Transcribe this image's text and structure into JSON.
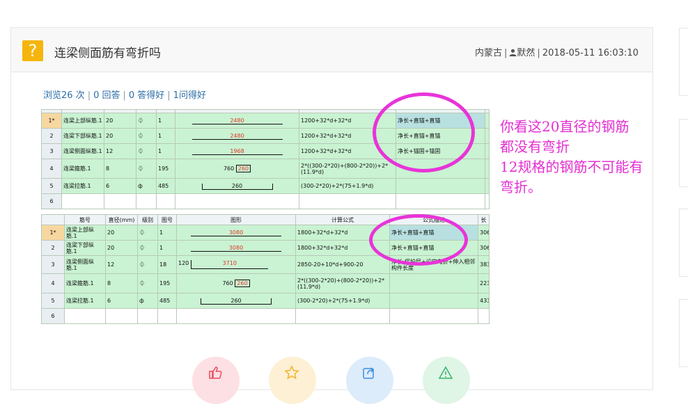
{
  "question": {
    "title": "连梁侧面筋有弯折吗",
    "region": "内蒙古",
    "user": "默然",
    "datetime": "2018-05-11 16:03:10"
  },
  "stats": {
    "views": "浏览26 次",
    "answers": "0 回答",
    "good_answers": "0 答得好",
    "helpful": "1问得好"
  },
  "software_top": {
    "rows": [
      {
        "no": "1*",
        "name": "连梁上部纵筋.1",
        "dia": "20",
        "grade": "⏀",
        "fig": "1",
        "shape": "2480",
        "formula": "1200+32*d+32*d",
        "desc": "净长+直锚+直锚"
      },
      {
        "no": "2",
        "name": "连梁下部纵筋.1",
        "dia": "20",
        "grade": "⏀",
        "fig": "1",
        "shape": "2480",
        "formula": "1200+32*d+32*d",
        "desc": "净长+直锚+直锚"
      },
      {
        "no": "3",
        "name": "连梁侧面纵筋.1",
        "dia": "12",
        "grade": "⏀",
        "fig": "1",
        "shape": "1968",
        "formula": "1200+32*d+32*d",
        "desc": "净长+锚固+锚固"
      },
      {
        "no": "4",
        "name": "连梁箍筋.1",
        "dia": "8",
        "grade": "⏀",
        "fig": "195",
        "shape_a": "760",
        "shape_b": "260",
        "formula": "2*((300-2*20)+(800-2*20))+2*(11.9*d)",
        "desc": ""
      },
      {
        "no": "5",
        "name": "连梁拉筋.1",
        "dia": "6",
        "grade": "ф",
        "fig": "485",
        "shape": "260",
        "formula": "(300-2*20)+2*(75+1.9*d)",
        "desc": ""
      },
      {
        "no": "6",
        "name": "",
        "dia": "",
        "grade": "",
        "fig": "",
        "shape": "",
        "formula": "",
        "desc": ""
      }
    ]
  },
  "software_bottom": {
    "headers": [
      "",
      "筋号",
      "直径(mm)",
      "级别",
      "图号",
      "图形",
      "计算公式",
      "公式描述",
      "长"
    ],
    "rows": [
      {
        "no": "1*",
        "name": "连梁上部纵筋.1",
        "dia": "20",
        "grade": "⏀",
        "fig": "1",
        "shape": "3080",
        "formula": "1800+32*d+32*d",
        "desc": "净长+直锚+直锚",
        "len": "306"
      },
      {
        "no": "2",
        "name": "连梁下部纵筋.1",
        "dia": "20",
        "grade": "⏀",
        "fig": "1",
        "shape": "3080",
        "formula": "1800+32*d+32*d",
        "desc": "净长+直锚+直锚",
        "len": "306"
      },
      {
        "no": "3",
        "name": "连梁侧面纵筋.1",
        "dia": "12",
        "grade": "⏀",
        "fig": "18",
        "shape_a": "120",
        "shape": "3710",
        "formula": "2850-20+10*d+900-20",
        "desc": "净长-保护层+设定弯折+伸入相邻构件长度",
        "len": "383"
      },
      {
        "no": "4",
        "name": "连梁箍筋.1",
        "dia": "8",
        "grade": "⏀",
        "fig": "195",
        "shape_a": "760",
        "shape_b": "260",
        "formula": "2*((300-2*20)+(800-2*20))+2*(11.9*d)",
        "desc": "",
        "len": "223"
      },
      {
        "no": "5",
        "name": "连梁拉筋.1",
        "dia": "6",
        "grade": "ф",
        "fig": "485",
        "shape": "260",
        "formula": "(300-2*20)+2*(75+1.9*d)",
        "desc": "",
        "len": "433"
      },
      {
        "no": "6",
        "name": "",
        "dia": "",
        "grade": "",
        "fig": "",
        "shape": "",
        "formula": "",
        "desc": "",
        "len": ""
      }
    ]
  },
  "annotation": {
    "line1": "你看这20直径的钢筋",
    "line2": "都没有弯折",
    "line3": "12规格的钢筋不可能有",
    "line4": "弯折。"
  },
  "icons": [
    "help-icon",
    "user-icon",
    "thumb-up-icon",
    "star-icon",
    "share-icon",
    "warning-icon"
  ],
  "colors": {
    "accent": "#f5b50c",
    "link": "#2c6ea8",
    "annotation": "#e42fd1",
    "cell_green": "#c9f3d2"
  }
}
